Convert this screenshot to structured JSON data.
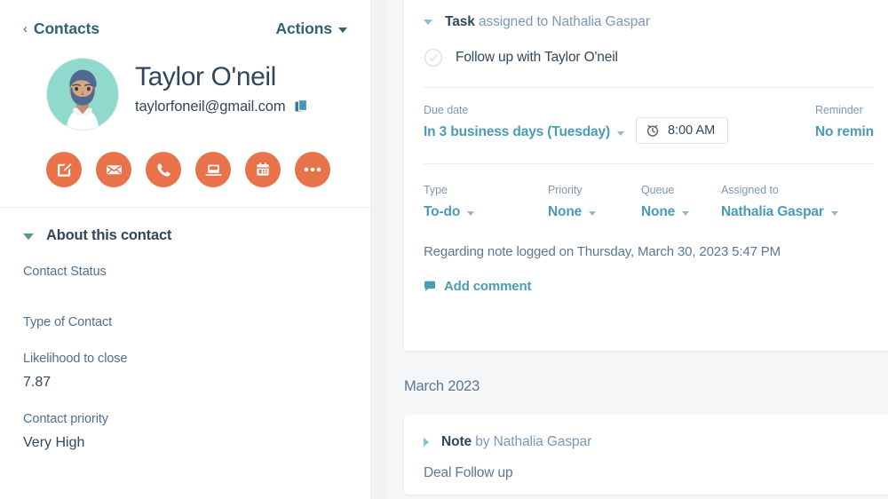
{
  "sidebar": {
    "back_link": "Contacts",
    "back_icon": "chevron-left-icon",
    "actions_label": "Actions",
    "contact": {
      "name": "Taylor O'neil",
      "email": "taylorfoneil@gmail.com",
      "copy_icon": "copy-icon",
      "avatar_icon": "user-avatar-illustration"
    },
    "quick_actions": [
      {
        "name": "note",
        "icon": "note-edit-icon",
        "label": "Note"
      },
      {
        "name": "email",
        "icon": "envelope-icon",
        "label": "Email"
      },
      {
        "name": "call",
        "icon": "phone-icon",
        "label": "Call"
      },
      {
        "name": "log",
        "icon": "log-activity-icon",
        "label": "Log"
      },
      {
        "name": "meeting",
        "icon": "calendar-icon",
        "label": "Meeting"
      },
      {
        "name": "more",
        "icon": "ellipsis-icon",
        "label": "More"
      }
    ],
    "about": {
      "title": "About this contact",
      "toggle_icon": "chevron-down-icon",
      "properties": [
        {
          "label": "Contact Status",
          "value": ""
        },
        {
          "label": "Type of Contact",
          "value": ""
        },
        {
          "label": "Likelihood to close",
          "value": "7.87"
        },
        {
          "label": "Contact priority",
          "value": "Very High"
        }
      ]
    }
  },
  "timeline": {
    "task_card": {
      "toggle_icon": "chevron-down-icon",
      "header_type": "Task",
      "header_rest": " assigned to Nathalia Gaspar",
      "checkbox_icon": "check-circle-icon",
      "task_name": "Follow up with Taylor O'neil",
      "due_date": {
        "label": "Due date",
        "value": "In 3 business days (Tuesday)",
        "time": "8:00 AM",
        "time_icon": "clock-icon"
      },
      "reminder": {
        "label": "Reminder",
        "value": "No remin"
      },
      "fields": [
        {
          "label": "Type",
          "value": "To-do"
        },
        {
          "label": "Priority",
          "value": "None"
        },
        {
          "label": "Queue",
          "value": "None"
        },
        {
          "label": "Assigned to",
          "value": "Nathalia Gaspar"
        }
      ],
      "regarding": "Regarding note logged on Thursday, March 30, 2023 5:47 PM",
      "add_comment": "Add comment",
      "comment_icon": "comment-bubble-icon"
    },
    "month_divider": "March 2023",
    "note_card": {
      "toggle_icon": "chevron-right-icon",
      "header_type": "Note",
      "header_rest": " by Nathalia Gaspar",
      "body": "Deal Follow up"
    }
  },
  "colors": {
    "accent_orange": "#e8734a",
    "link_teal": "#4a9cb5",
    "nav_teal": "#33626f",
    "text_dark": "#33475b",
    "text_muted": "#7c98b6",
    "avatar_bg": "#8fd9cd"
  }
}
